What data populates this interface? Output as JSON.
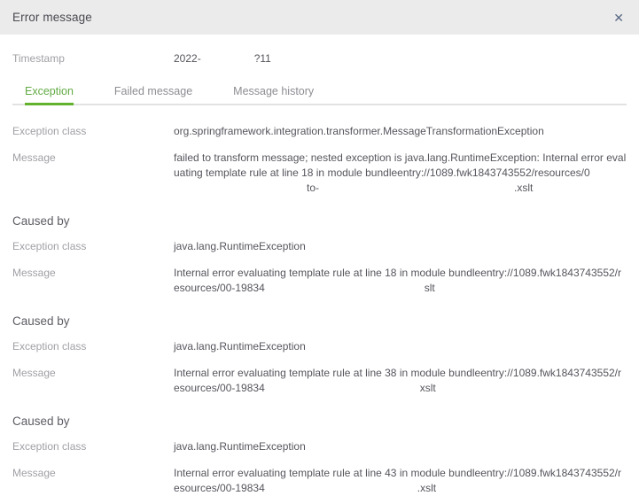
{
  "dialog": {
    "title": "Error message",
    "close_icon": "close-icon",
    "close_glyph": "✕"
  },
  "timestamp": {
    "label": "Timestamp",
    "value_visible_start": "2022-",
    "value_redacted": "                  ",
    "value_visible_end": "?11"
  },
  "tabs": [
    {
      "label": "Exception",
      "active": true
    },
    {
      "label": "Failed message",
      "active": false
    },
    {
      "label": "Message history",
      "active": false
    }
  ],
  "labels": {
    "exception_class": "Exception class",
    "message": "Message",
    "caused_by": "Caused by"
  },
  "exception": {
    "class": "org.springframework.integration.transformer.MessageTransformationException",
    "message_part1": "failed to transform message; nested exception is java.lang.RuntimeException: Internal error evaluating template rule at line 18 in module bundleentry://1089.fwk1843743552/resources/0",
    "message_redacted": " ",
    "message_part2": "to-",
    "message_part3": ".xslt"
  },
  "caused_by": [
    {
      "heading": "Caused by",
      "class": "java.lang.RuntimeException",
      "message_part1": "Internal error evaluating template rule at line 18 in module bundleentry://1089.fwk1843743552/resources/00-19834",
      "message_part2": "slt"
    },
    {
      "heading": "Caused by",
      "class": "java.lang.RuntimeException",
      "message_part1": "Internal error evaluating template rule at line 38 in module bundleentry://1089.fwk1843743552/resources/00-19834",
      "message_part2": "xslt"
    },
    {
      "heading": "Caused by",
      "class": "java.lang.RuntimeException",
      "message_part1": "Internal error evaluating template rule at line 43 in module bundleentry://1089.fwk1843743552/resources/00-19834",
      "message_part2": ".xslt"
    }
  ],
  "colors": {
    "header_background": "#ebebeb",
    "accent_green": "#62b22e",
    "tab_active_text": "#63ab45",
    "label_gray": "#a0a0a6",
    "value_gray": "#55555d",
    "divider": "#e2e2e2"
  }
}
